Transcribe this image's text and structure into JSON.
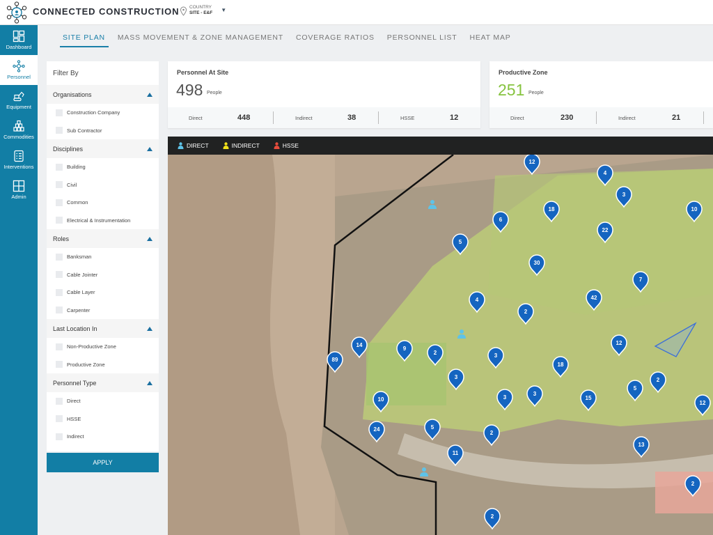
{
  "app": {
    "title": "CONNECTED CONSTRUCTION",
    "site_line1": "COUNTRY",
    "site_line2": "SITE - E&F"
  },
  "nav": [
    {
      "id": "dashboard",
      "label": "Dashboard",
      "icon": "dashboard-icon",
      "active": false
    },
    {
      "id": "personnel",
      "label": "Personnel",
      "icon": "network-icon",
      "active": true
    },
    {
      "id": "equipment",
      "label": "Equipment",
      "icon": "excavator-icon",
      "active": false
    },
    {
      "id": "commodities",
      "label": "Commodities",
      "icon": "stack-icon",
      "active": false
    },
    {
      "id": "interventions",
      "label": "Interventions",
      "icon": "checklist-icon",
      "active": false
    },
    {
      "id": "admin",
      "label": "Admin",
      "icon": "admin-grid-icon",
      "active": false
    }
  ],
  "tabs": [
    {
      "label": "SITE PLAN",
      "active": true
    },
    {
      "label": "MASS MOVEMENT & ZONE MANAGEMENT",
      "active": false
    },
    {
      "label": "COVERAGE RATIOS",
      "active": false
    },
    {
      "label": "PERSONNEL LIST",
      "active": false
    },
    {
      "label": "HEAT MAP",
      "active": false
    }
  ],
  "filter": {
    "title": "Filter By",
    "sections": [
      {
        "title": "Organisations",
        "options": [
          "Construction Company",
          "Sub Contractor"
        ]
      },
      {
        "title": "Disciplines",
        "options": [
          "Building",
          "Civil",
          "Common",
          "Electrical & Instrumentation"
        ]
      },
      {
        "title": "Roles",
        "options": [
          "Banksman",
          "Cable Jointer",
          "Cable Layer",
          "Carpenter"
        ]
      },
      {
        "title": "Last Location In",
        "options": [
          "Non-Productive Zone",
          "Productive Zone"
        ]
      },
      {
        "title": "Personnel Type",
        "options": [
          "Direct",
          "HSSE",
          "Indirect"
        ]
      }
    ],
    "apply_label": "APPLY"
  },
  "cards": {
    "personnel": {
      "title": "Personnel At Site",
      "total": "498",
      "unit": "People",
      "direct_label": "Direct",
      "direct": "448",
      "indirect_label": "Indirect",
      "indirect": "38",
      "hsse_label": "HSSE",
      "hsse": "12"
    },
    "productive": {
      "title": "Productive Zone",
      "total": "251",
      "unit": "People",
      "direct_label": "Direct",
      "direct": "230",
      "indirect_label": "Indirect",
      "indirect": "21"
    }
  },
  "legend": {
    "direct": "DIRECT",
    "indirect": "INDIRECT",
    "hsse": "HSSE",
    "colors": {
      "direct": "#5ec3e8",
      "indirect": "#f2e21a",
      "hsse": "#e74c3c"
    }
  },
  "map": {
    "marker_color": "#1565c0",
    "markers": [
      "12",
      "4",
      "3",
      "10",
      "18",
      "6",
      "5",
      "22",
      "30",
      "7",
      "42",
      "4",
      "2",
      "12",
      "14",
      "9",
      "2",
      "10",
      "3",
      "18",
      "3",
      "2",
      "3",
      "5",
      "3",
      "15",
      "12",
      "5",
      "2",
      "11",
      "13",
      "2",
      "2",
      "24",
      "89",
      "2"
    ]
  }
}
